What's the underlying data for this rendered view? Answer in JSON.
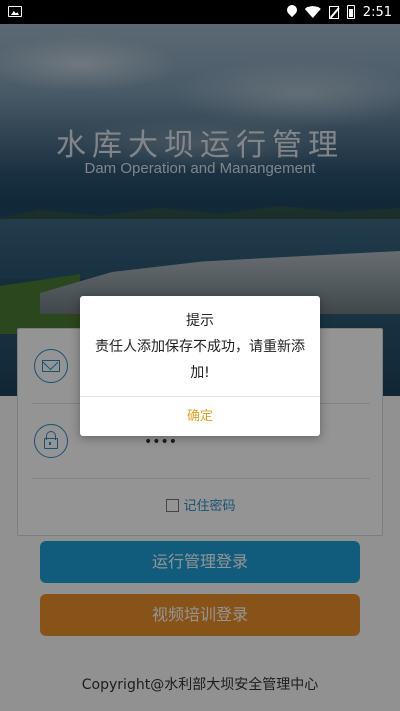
{
  "status_bar": {
    "time": "2:51",
    "icons": [
      "image-icon",
      "location-icon",
      "wifi-icon",
      "no-sim-icon",
      "battery-icon"
    ]
  },
  "hero": {
    "title": "水库大坝运行管理",
    "subtitle": "Dam Operation and Manangement"
  },
  "login": {
    "username_icon": "mail-icon",
    "username_value": "",
    "password_icon": "lock-icon",
    "password_value": "••••",
    "remember_label": "记住密码",
    "remember_checked": false
  },
  "buttons": {
    "run_label": "运行管理登录",
    "video_label": "视频培训登录"
  },
  "footer": {
    "copyright": "Copyright@水利部大坝安全管理中心"
  },
  "dialog": {
    "title": "提示",
    "message": "责任人添加保存不成功，请重新添加!",
    "ok_label": "确定"
  },
  "colors": {
    "primary_blue": "#1e9ed6",
    "accent_orange": "#e8902a",
    "dialog_button": "#e8a020"
  }
}
